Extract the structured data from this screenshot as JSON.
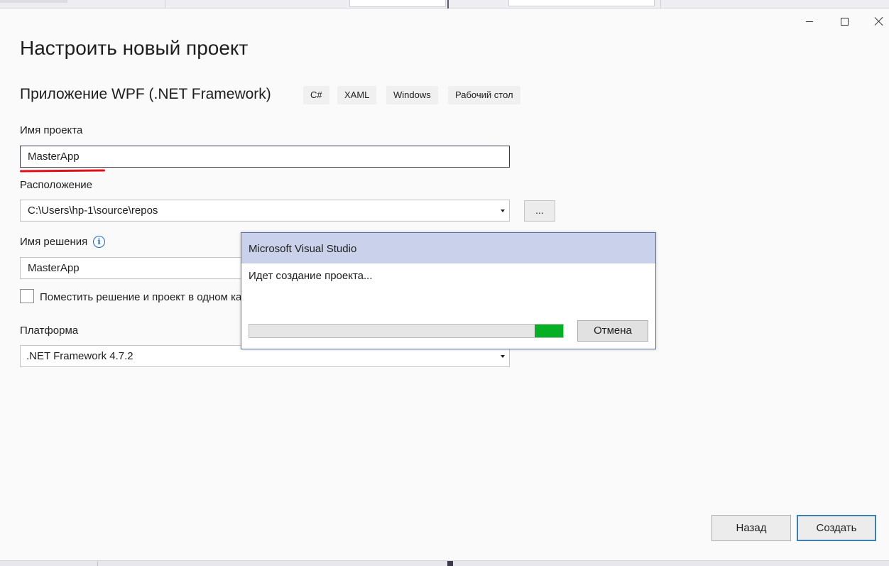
{
  "window": {
    "title": "Настроить новый проект",
    "controls": {
      "minimize_icon": "minimize-icon",
      "maximize_icon": "maximize-icon",
      "close_icon": "close-icon"
    }
  },
  "template": {
    "name": "Приложение WPF (.NET Framework)",
    "tags": [
      "C#",
      "XAML",
      "Windows",
      "Рабочий стол"
    ]
  },
  "form": {
    "project_name": {
      "label": "Имя проекта",
      "value": "MasterApp"
    },
    "location": {
      "label": "Расположение",
      "value": "C:\\Users\\hp-1\\source\\repos",
      "browse_label": "..."
    },
    "solution_name": {
      "label": "Имя решения",
      "value": "MasterApp",
      "info_icon": "info-icon"
    },
    "same_folder": {
      "label": "Поместить решение и проект в одном ка",
      "checked": false
    },
    "platform": {
      "label": "Платформа",
      "value": ".NET Framework 4.7.2"
    }
  },
  "footer": {
    "back_label": "Назад",
    "create_label": "Создать"
  },
  "dialog": {
    "title": "Microsoft Visual Studio",
    "message": "Идет создание проекта...",
    "progress": 0.09,
    "cancel_label": "Отмена"
  },
  "colors": {
    "accent": "#3c7fb1",
    "dialog_header": "#cad1ea",
    "progress_fill": "#06b025",
    "annotation": "#e0101a"
  }
}
